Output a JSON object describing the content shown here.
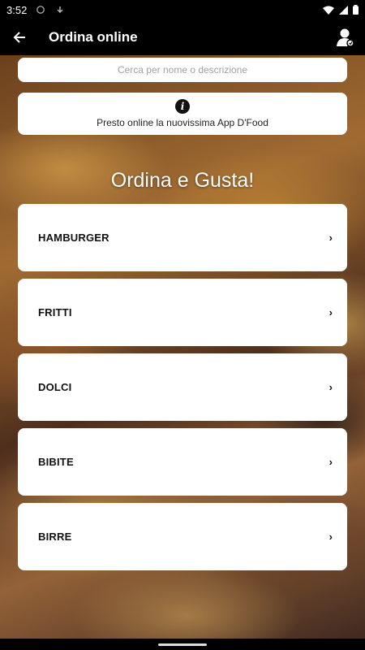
{
  "status_bar": {
    "time": "3:52"
  },
  "toolbar": {
    "title": "Ordina online",
    "back_icon": "arrow-left-icon",
    "profile_icon": "user-account-icon"
  },
  "search": {
    "placeholder": "Cerca per nome o descrizione"
  },
  "info": {
    "icon": "info-icon",
    "text": "Presto online la nuovissima App D'Food"
  },
  "heading": "Ordina e Gusta!",
  "categories": [
    {
      "label": "HAMBURGER"
    },
    {
      "label": "FRITTI"
    },
    {
      "label": "DOLCI"
    },
    {
      "label": "BIBITE"
    },
    {
      "label": "BIRRE"
    }
  ],
  "chevron_glyph": "›",
  "colors": {
    "toolbar": "#000000",
    "card": "#ffffff",
    "text": "#111111"
  }
}
